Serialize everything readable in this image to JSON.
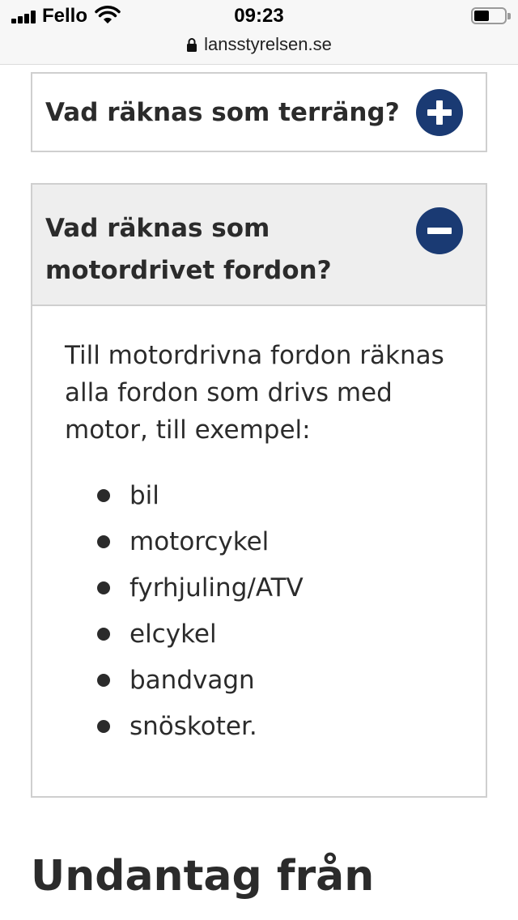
{
  "status_bar": {
    "carrier": "Fello",
    "time": "09:23",
    "url": "lansstyrelsen.se",
    "icons": [
      "signal-icon",
      "wifi-icon",
      "battery-icon",
      "lock-icon"
    ]
  },
  "accordions": [
    {
      "title": "Vad räknas som terräng?",
      "expanded": false,
      "toggle_icon": "plus-icon"
    },
    {
      "title": "Vad räknas som motordrivet fordon?",
      "expanded": true,
      "toggle_icon": "minus-icon",
      "body_text": "Till motordrivna fordon räknas alla fordon som drivs med motor, till exempel:",
      "items": [
        "bil",
        "motorcykel",
        "fyrhjuling/ATV",
        "elcykel",
        "bandvagn",
        "snöskoter."
      ]
    }
  ],
  "next_section_heading": "Undantag från",
  "colors": {
    "toggle_bg": "#1a3a73",
    "expanded_header_bg": "#eeeeee",
    "border": "#cfcfcf",
    "text": "#2b2b2b"
  }
}
